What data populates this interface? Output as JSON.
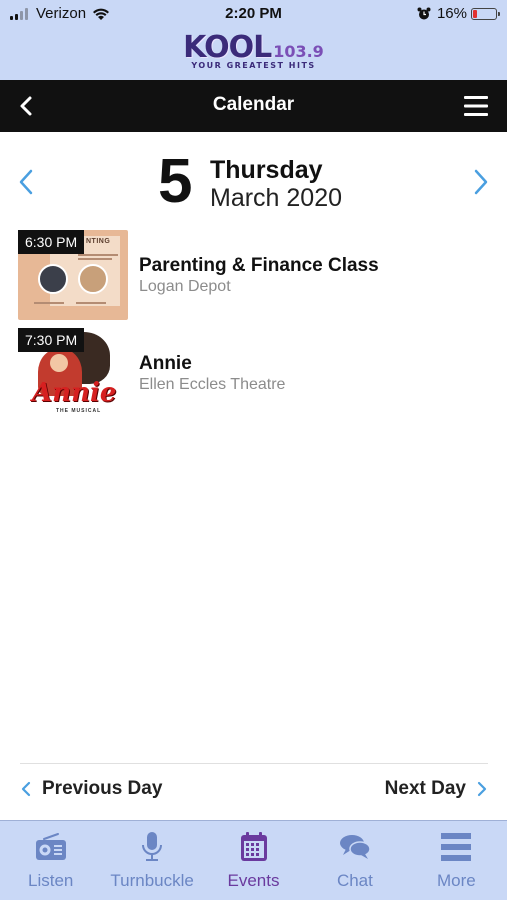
{
  "status_bar": {
    "carrier": "Verizon",
    "time": "2:20 PM",
    "battery_percent": "16%",
    "battery_level": 0.16
  },
  "logo": {
    "word": "KOOL",
    "frequency": "103.9",
    "tagline": "YOUR GREATEST HITS"
  },
  "header": {
    "title": "Calendar"
  },
  "date": {
    "day_number": "5",
    "weekday": "Thursday",
    "month_year": "March 2020"
  },
  "events": [
    {
      "time": "6:30 PM",
      "title": "Parenting & Finance Class",
      "venue": "Logan Depot",
      "thumb_word": "NTING"
    },
    {
      "time": "7:30 PM",
      "title": "Annie",
      "venue": "Ellen Eccles Theatre",
      "thumb_title": "Annie",
      "thumb_sub": "THE MUSICAL"
    }
  ],
  "day_nav": {
    "previous": "Previous Day",
    "next": "Next Day"
  },
  "tabs": [
    {
      "label": "Listen",
      "icon": "radio-icon"
    },
    {
      "label": "Turnbuckle",
      "icon": "microphone-icon"
    },
    {
      "label": "Events",
      "icon": "calendar-icon",
      "active": true
    },
    {
      "label": "Chat",
      "icon": "chat-icon"
    },
    {
      "label": "More",
      "icon": "menu-icon"
    }
  ],
  "colors": {
    "accent": "#4a9fe0",
    "tab_inactive": "#6b86c4",
    "tab_active": "#6a3a9e",
    "header_bg": "#111111",
    "top_bg": "#c9d8f6"
  }
}
